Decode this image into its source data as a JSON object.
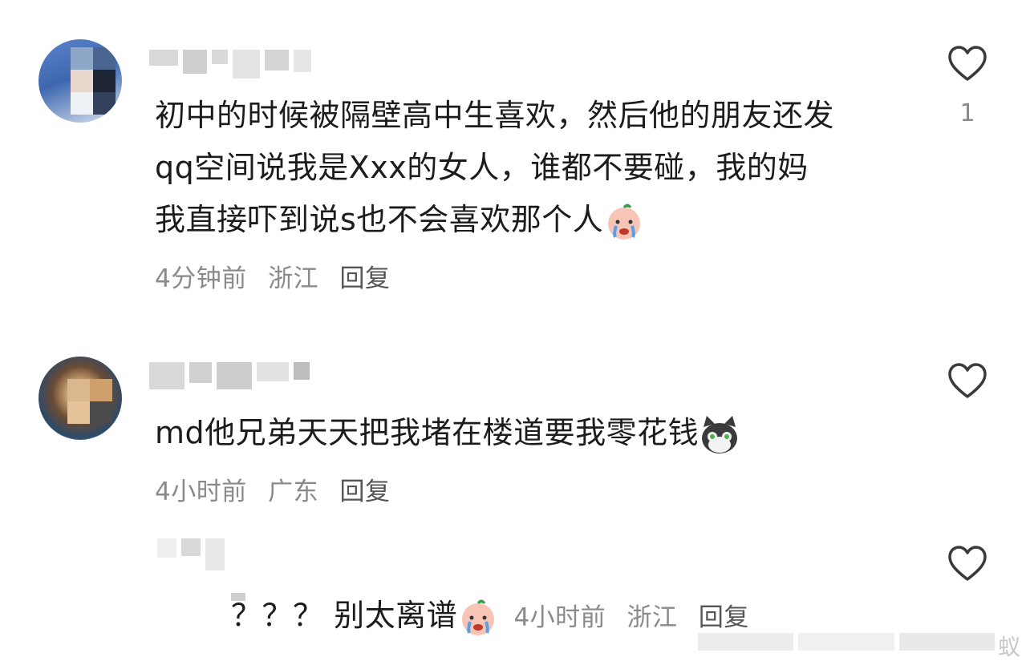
{
  "comments": [
    {
      "text_lines": [
        "初中的时候被隔壁高中生喜欢，然后他的朋友还发",
        "qq空间说我是Xxx的女人，谁都不要碰，我的妈",
        "我直接吓到说s也不会喜欢那个人"
      ],
      "emoji": "crying-face-emoji",
      "time": "4分钟前",
      "location": "浙江",
      "reply_label": "回复",
      "like_count": "1"
    },
    {
      "text": "md他兄弟天天把我堵在楼道要我零花钱",
      "emoji": "cat-face-emoji",
      "time": "4小时前",
      "location": "广东",
      "reply_label": "回复"
    }
  ],
  "reply": {
    "prefix": "？？？ 别太离谱",
    "emoji": "crying-face-emoji",
    "time": "4小时前",
    "location": "浙江",
    "reply_label": "回复"
  },
  "watermark": "蚁"
}
